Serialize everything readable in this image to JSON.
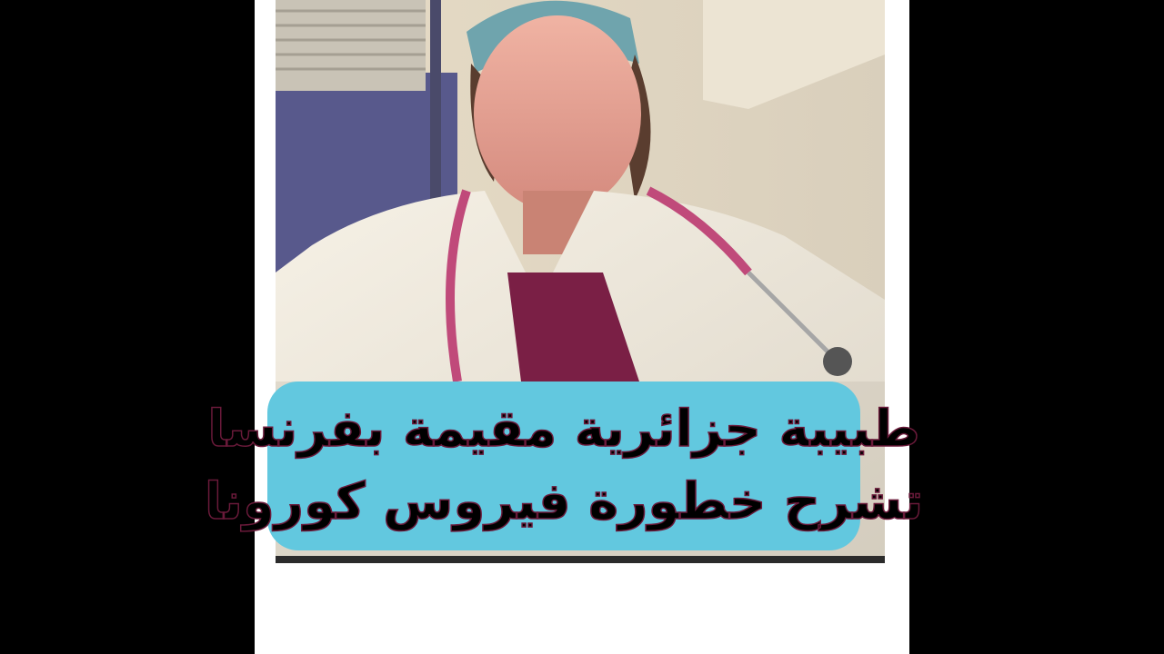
{
  "caption": {
    "line1": "طبيبة جزائرية مقيمة بفرنسا",
    "line2": "تشرح خطورة فيروس كورونا",
    "background_color": "#62c8df",
    "text_color": "#000000"
  },
  "photo": {
    "subject": "doctor-in-white-coat-with-stethoscope"
  },
  "colors": {
    "side_bars": "#000000",
    "canvas": "#ffffff"
  }
}
